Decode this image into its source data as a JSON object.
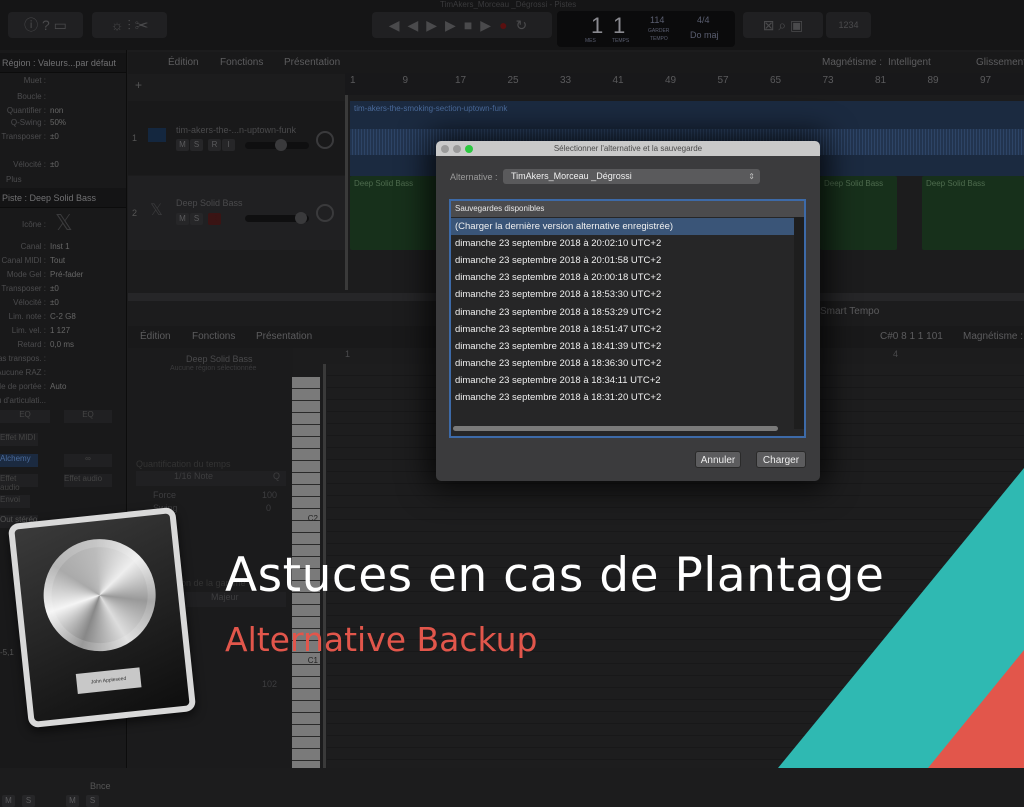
{
  "window": {
    "title": "TimAkers_Morceau _Dégrossi - Pistes"
  },
  "lcd": {
    "bar": "1",
    "beat": "1",
    "bar_label": "MES",
    "beat_label": "TEMPS",
    "tempo": "114",
    "tempo_label": "GARDER",
    "tempo_sub": "TEMPO",
    "signature": "4/4",
    "key": "Do maj"
  },
  "control_bar": {
    "counter_label": "1234"
  },
  "inspector": {
    "region_header": "Région : Valeurs...par défaut",
    "region_fields": [
      {
        "label": "Muet :",
        "value": ""
      },
      {
        "label": "Boucle :",
        "value": ""
      },
      {
        "label": "Quantifier :",
        "value": "non"
      },
      {
        "label": "Q-Swing :",
        "value": "50%"
      },
      {
        "label": "Transposer :",
        "value": "±0"
      },
      {
        "label": "Vélocité :",
        "value": "±0"
      }
    ],
    "more": "Plus",
    "track_header": "Piste : Deep Solid Bass",
    "track_fields": [
      {
        "label": "Icône :",
        "value": ""
      },
      {
        "label": "Canal :",
        "value": "Inst 1"
      },
      {
        "label": "Canal MIDI :",
        "value": "Tout"
      },
      {
        "label": "Mode Gel :",
        "value": "Pré-fader"
      },
      {
        "label": "Transposer :",
        "value": "±0"
      },
      {
        "label": "Vélocité :",
        "value": "±0"
      },
      {
        "label": "Lim. note :",
        "value": "C-2  G8"
      },
      {
        "label": "Lim. vel. :",
        "value": "1  127"
      },
      {
        "label": "Retard :",
        "value": "0,0 ms"
      },
      {
        "label": "Pas transpos. :",
        "value": ""
      },
      {
        "label": "Aucune RAZ :",
        "value": ""
      },
      {
        "label": "Style de portée :",
        "value": "Auto"
      },
      {
        "label": "Jeu d'articulati...",
        "value": ""
      }
    ],
    "strip": {
      "eq1": "EQ",
      "eq2": "EQ",
      "midi_fx": "Effet MIDI",
      "instrument": "Alchemy",
      "link": "∞",
      "audio_fx1": "Effet audio",
      "audio_fx2": "Effet audio",
      "send": "Envoi",
      "output": "Out stéréo",
      "value": "-5,1",
      "bounce": "Bnce",
      "m": "M",
      "s": "S"
    }
  },
  "tracks_area": {
    "menus": [
      "Édition",
      "Fonctions",
      "Présentation"
    ],
    "snap_label": "Magnétisme :",
    "snap_value": "Intelligent",
    "drag_label": "Glissement",
    "ruler": [
      "1",
      "9",
      "17",
      "25",
      "33",
      "41",
      "49",
      "57",
      "65",
      "73",
      "81",
      "89",
      "97",
      "10"
    ],
    "tracks": [
      {
        "number": "1",
        "name": "tim-akers-the-...n-uptown-funk",
        "buttons": [
          "M",
          "S",
          "R",
          "I"
        ]
      },
      {
        "number": "2",
        "name": "Deep Solid Bass",
        "buttons": [
          "M",
          "S",
          "R"
        ]
      }
    ],
    "audio_region": "tim-akers-the-smoking-section-uptown-funk",
    "midi_region": "Deep Solid Bass"
  },
  "editor": {
    "menus": [
      "Édition",
      "Fonctions",
      "Présentation"
    ],
    "track_name": "Deep Solid Bass",
    "no_region": "Aucune région sélectionnée",
    "smart_tempo": "Smart Tempo",
    "position": "C#0  8 1 1 101",
    "snap_label": "Magnétisme :",
    "ruler": [
      "1",
      "4"
    ],
    "quant_label": "Quantification du temps",
    "quant_value": "1/16 Note",
    "q_btn": "Q",
    "force_label": "Force",
    "force_value": "100",
    "swing_label": "Swing",
    "swing_value": "0",
    "scale_label": "Quantification de la gamme",
    "scale_value": "Majeur",
    "velocity_value": "102",
    "keys": [
      "C2",
      "C1"
    ]
  },
  "dialog": {
    "title": "Sélectionner l'alternative et la sauvegarde",
    "alternative_label": "Alternative :",
    "alternative_value": "TimAkers_Morceau _Dégrossi",
    "list_header": "Sauvegardes disponibles",
    "items": [
      "(Charger la dernière version alternative enregistrée)",
      "dimanche 23 septembre 2018 à 20:02:10 UTC+2",
      "dimanche 23 septembre 2018 à 20:01:58 UTC+2",
      "dimanche 23 septembre 2018 à 20:00:18 UTC+2",
      "dimanche 23 septembre 2018 à 18:53:30 UTC+2",
      "dimanche 23 septembre 2018 à 18:53:29 UTC+2",
      "dimanche 23 septembre 2018 à 18:51:47 UTC+2",
      "dimanche 23 septembre 2018 à 18:41:39 UTC+2",
      "dimanche 23 septembre 2018 à 18:36:30 UTC+2",
      "dimanche 23 septembre 2018 à 18:34:11 UTC+2",
      "dimanche 23 septembre 2018 à 18:31:20 UTC+2"
    ],
    "selected_index": 0,
    "cancel": "Annuler",
    "load": "Charger"
  },
  "overlay": {
    "title": "Astuces en cas de Plantage",
    "subtitle": "Alternative Backup",
    "logo_text": "John Appleseed",
    "accent_teal": "#2fb9b2",
    "accent_coral": "#e2564b"
  }
}
